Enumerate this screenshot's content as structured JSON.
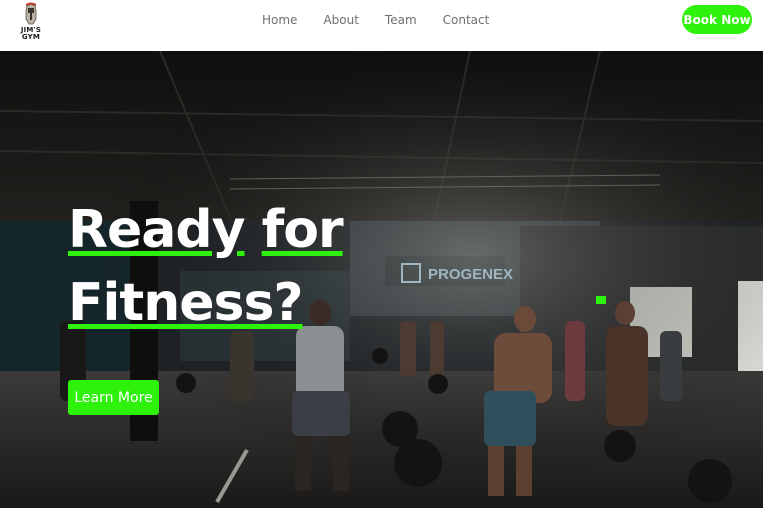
{
  "header": {
    "logo_text": "JIM'S\nGYM",
    "nav": [
      {
        "label": "Home"
      },
      {
        "label": "About"
      },
      {
        "label": "Team"
      },
      {
        "label": "Contact"
      }
    ],
    "cta_label": "Book Now"
  },
  "hero": {
    "headline_line1_a": "Ready",
    "headline_line1_b": "for",
    "headline_line2": "Fitness?",
    "button_label": "Learn More",
    "background_sign": "PROGENEX",
    "background_image": "gym interior with people training"
  },
  "colors": {
    "accent": "#2ef20c",
    "nav_text": "#6f6f6f",
    "header_bg": "#ffffff",
    "hero_text": "#ffffff"
  }
}
